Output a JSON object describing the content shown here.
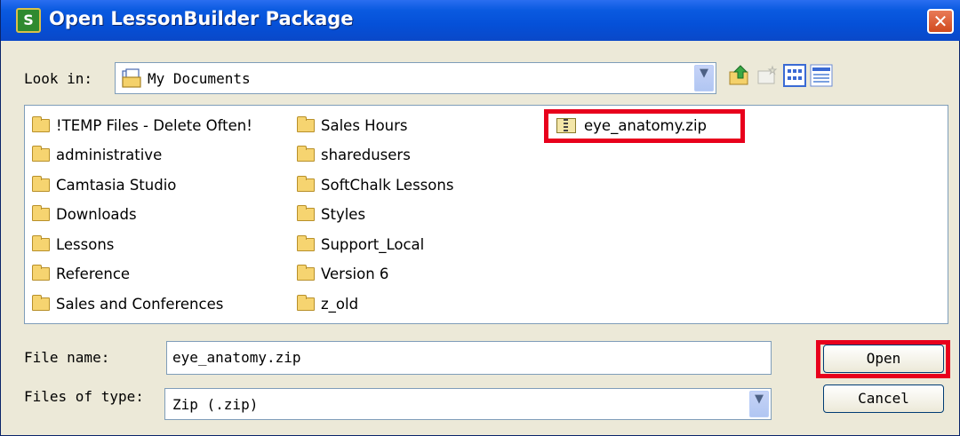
{
  "window": {
    "title": "Open LessonBuilder Package",
    "close_glyph": "✕"
  },
  "look_in": {
    "label": "Look in:",
    "value": "My  Documents"
  },
  "files": {
    "column1": [
      "!TEMP Files - Delete Often!",
      "administrative",
      "Camtasia Studio",
      "Downloads",
      "Lessons",
      "Reference",
      "Sales and Conferences"
    ],
    "column2": [
      "Sales Hours",
      "sharedusers",
      "SoftChalk Lessons",
      "Styles",
      "Support_Local",
      "Version 6",
      "z_old"
    ],
    "zip_file": "eye_anatomy.zip"
  },
  "file_name": {
    "label": "File name:",
    "value": "eye_anatomy.zip"
  },
  "file_type": {
    "label": "Files of type:",
    "value": "Zip (.zip)"
  },
  "buttons": {
    "open": "Open",
    "cancel": "Cancel"
  },
  "colors": {
    "highlight": "#e8001c",
    "titlebar": "#0550d8"
  }
}
